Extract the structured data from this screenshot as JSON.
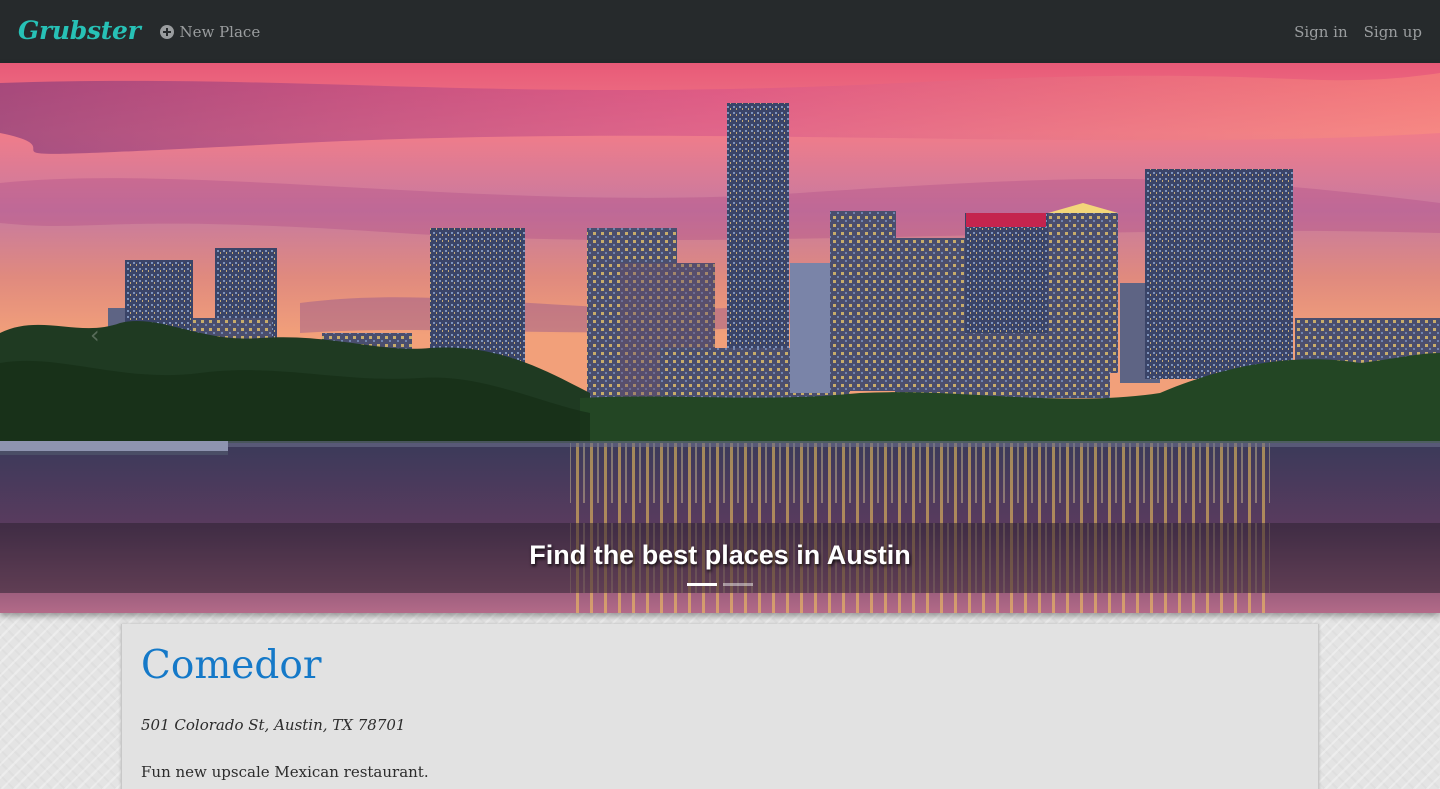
{
  "navbar": {
    "brand": "Grubster",
    "new_place_label": "New Place",
    "sign_in_label": "Sign in",
    "sign_up_label": "Sign up",
    "new_place_icon": "plus-circle-icon"
  },
  "hero": {
    "caption": "Find the best places in Austin",
    "prev_icon": "chevron-left-icon",
    "prev_glyph": "‹",
    "slide_count": 2,
    "active_slide": 1
  },
  "place": {
    "name": "Comedor",
    "address": "501 Colorado St, Austin, TX 78701",
    "description": "Fun new upscale Mexican restaurant."
  },
  "colors": {
    "navbar_bg": "#262a2c",
    "brand": "#27c1b6",
    "nav_link": "#9a9d9f",
    "place_title": "#1579c8"
  }
}
